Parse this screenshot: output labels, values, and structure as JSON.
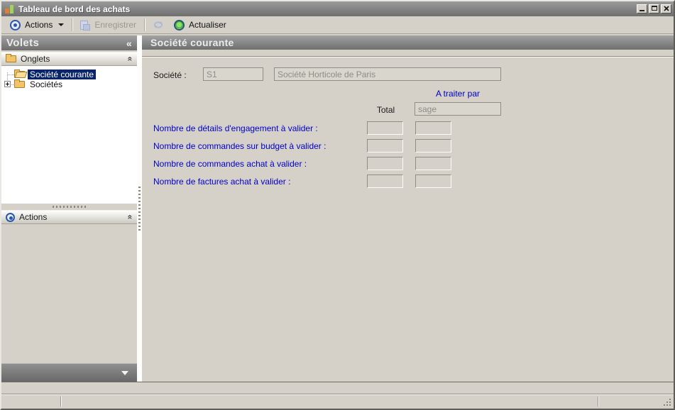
{
  "window": {
    "title": "Tableau de bord des achats"
  },
  "toolbar": {
    "actions_label": "Actions",
    "save_label": "Enregistrer",
    "refresh_label": "Actualiser"
  },
  "sidebar": {
    "title": "Volets",
    "icons": {
      "collapse_left": "«",
      "collapse_up": "«"
    },
    "sections": {
      "onglets_label": "Onglets",
      "actions_label": "Actions"
    },
    "tree": [
      {
        "label": "Société courante",
        "selected": true
      },
      {
        "label": "Sociétés",
        "selected": false,
        "expandable": true
      }
    ]
  },
  "main": {
    "title": "Société courante",
    "form": {
      "company_label": "Société :",
      "company_code": "S1",
      "company_name": "Société Horticole de Paris",
      "col_total_label": "Total",
      "col_traiter_label": "A traiter par",
      "user_value": "sage",
      "rows": [
        {
          "label": "Nombre de détails d'engagement à valider :",
          "total": "",
          "a_traiter": ""
        },
        {
          "label": "Nombre de commandes sur budget à valider :",
          "total": "",
          "a_traiter": ""
        },
        {
          "label": "Nombre de commandes achat à valider :",
          "total": "",
          "a_traiter": ""
        },
        {
          "label": "Nombre de factures achat à valider :",
          "total": "",
          "a_traiter": ""
        }
      ]
    }
  },
  "colors": {
    "selection_bg": "#0a246a",
    "label_blue": "#0000c8",
    "header_gray": "#8a8a8a",
    "panel_bg": "#d5d1c9"
  }
}
